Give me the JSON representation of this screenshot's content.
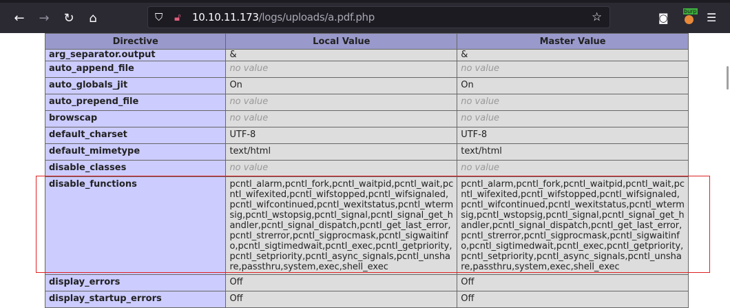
{
  "browser": {
    "url_host": "10.10.11.173",
    "url_path": "/logs/uploads/a.pdf.php",
    "burp_label": "burp"
  },
  "table": {
    "headers": [
      "Directive",
      "Local Value",
      "Master Value"
    ],
    "rows": [
      {
        "name": "arg_separator.output",
        "local": "&",
        "master": "&"
      },
      {
        "name": "auto_append_file",
        "local": "no value",
        "master": "no value",
        "novalue": true
      },
      {
        "name": "auto_globals_jit",
        "local": "On",
        "master": "On"
      },
      {
        "name": "auto_prepend_file",
        "local": "no value",
        "master": "no value",
        "novalue": true
      },
      {
        "name": "browscap",
        "local": "no value",
        "master": "no value",
        "novalue": true
      },
      {
        "name": "default_charset",
        "local": "UTF-8",
        "master": "UTF-8"
      },
      {
        "name": "default_mimetype",
        "local": "text/html",
        "master": "text/html"
      },
      {
        "name": "disable_classes",
        "local": "no value",
        "master": "no value",
        "novalue": true
      },
      {
        "name": "disable_functions",
        "lines": [
          "pcntl_alarm,pcntl_fork,pcntl_waitpid,pcntl_wait,pc",
          "ntl_wifexited,pcntl_wifstopped,pcntl_wifsignaled,",
          "pcntl_wifcontinued,pcntl_wexitstatus,pcntl_wterm",
          "sig,pcntl_wstopsig,pcntl_signal,pcntl_signal_get_h",
          "andler,pcntl_signal_dispatch,pcntl_get_last_error,",
          "pcntl_strerror,pcntl_sigprocmask,pcntl_sigwaitinf",
          "o,pcntl_sigtimedwait,pcntl_exec,pcntl_getpriority,",
          "pcntl_setpriority,pcntl_async_signals,pcntl_unsha",
          "re,passthru,system,exec,shell_exec"
        ]
      },
      {
        "name": "display_errors",
        "local": "Off",
        "master": "Off"
      },
      {
        "name": "display_startup_errors",
        "local": "Off",
        "master": "Off"
      }
    ]
  }
}
